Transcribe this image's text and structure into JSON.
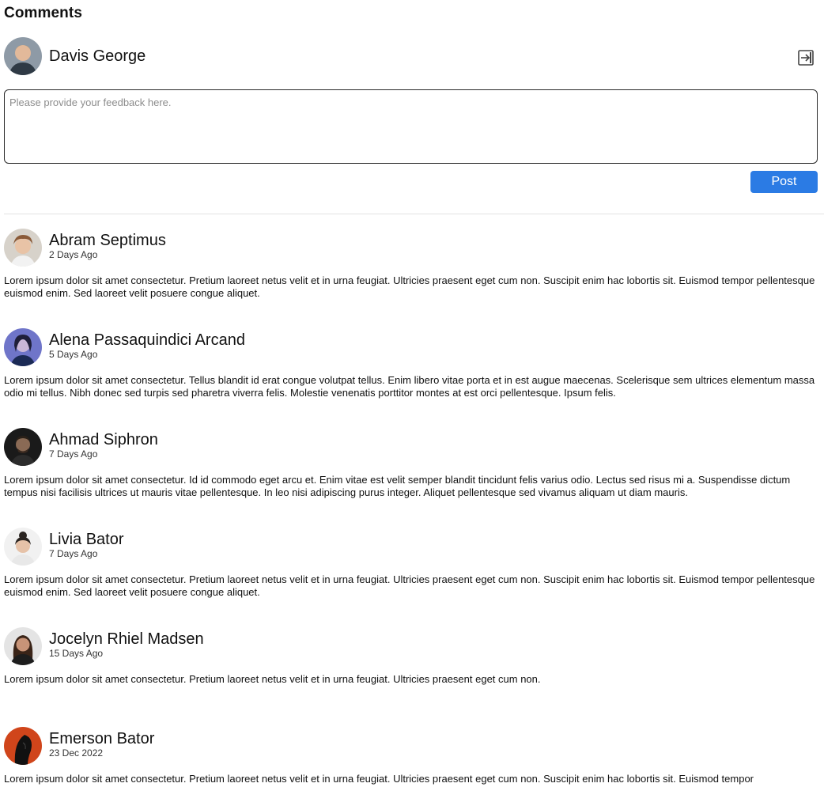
{
  "header": {
    "title": "Comments"
  },
  "current_user": {
    "name": "Davis George",
    "avatar_icon": "user-avatar"
  },
  "logout": {
    "icon": "logout-icon"
  },
  "composer": {
    "placeholder": "Please provide your feedback here.",
    "value": "",
    "post_label": "Post"
  },
  "colors": {
    "accent": "#2b7be4",
    "divider": "#e3e3e3"
  },
  "comments": [
    {
      "author": "Abram Septimus",
      "time": "2 Days Ago",
      "text": "Lorem ipsum dolor sit amet consectetur. Pretium laoreet netus velit et in urna feugiat. Ultricies praesent eget cum non. Suscipit enim hac lobortis sit. Euismod tempor pellentesque euismod enim. Sed laoreet velit posuere congue aliquet."
    },
    {
      "author": "Alena Passaquindici Arcand",
      "time": "5 Days Ago",
      "text": "Lorem ipsum dolor sit amet consectetur. Tellus blandit id erat congue volutpat tellus. Enim libero vitae porta et in est augue maecenas. Scelerisque sem ultrices elementum massa odio mi tellus. Nibh donec sed turpis sed pharetra viverra felis. Molestie venenatis porttitor montes at est orci pellentesque. Ipsum felis."
    },
    {
      "author": "Ahmad Siphron",
      "time": "7 Days Ago",
      "text": "Lorem ipsum dolor sit amet consectetur. Id id commodo eget arcu et. Enim vitae est velit semper blandit tincidunt felis varius odio. Lectus sed risus mi a. Suspendisse dictum tempus nisi facilisis ultrices ut mauris vitae pellentesque. In leo nisi adipiscing purus integer. Aliquet pellentesque sed vivamus aliquam ut diam mauris."
    },
    {
      "author": "Livia Bator",
      "time": "7 Days Ago",
      "text": "Lorem ipsum dolor sit amet consectetur. Pretium laoreet netus velit et in urna feugiat. Ultricies praesent eget cum non. Suscipit enim hac lobortis sit. Euismod tempor pellentesque euismod enim. Sed laoreet velit posuere congue aliquet."
    },
    {
      "author": "Jocelyn Rhiel Madsen",
      "time": "15 Days Ago",
      "text": "Lorem ipsum dolor sit amet consectetur. Pretium laoreet netus velit et in urna feugiat. Ultricies praesent eget cum non."
    },
    {
      "author": "Emerson Bator",
      "time": "23 Dec 2022",
      "text": "Lorem ipsum dolor sit amet consectetur. Pretium laoreet netus velit et in urna feugiat. Ultricies praesent eget cum non. Suscipit enim hac lobortis sit. Euismod tempor"
    }
  ]
}
